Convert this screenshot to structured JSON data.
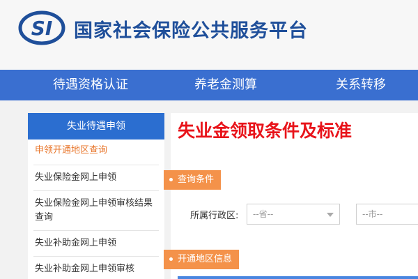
{
  "header": {
    "title": "国家社会保险公共服务平台",
    "logo_text": "SI"
  },
  "nav": {
    "items": [
      "待遇资格认证",
      "养老金测算",
      "关系转移"
    ]
  },
  "sidebar": {
    "heading": "失业待遇申领",
    "items": [
      "申领开通地区查询",
      "失业保险金网上申领",
      "失业保险金网上申领审核结果查询",
      "失业补助金网上申领",
      "失业补助金网上申领审核"
    ]
  },
  "main": {
    "title": "失业金领取条件及标准",
    "query_section": "查询条件",
    "region_label": "所属行政区:",
    "province_placeholder": "--省--",
    "city_placeholder": "--市--",
    "open_region_section": "开通地区信息"
  },
  "colors": {
    "brand_blue": "#3a6fd0",
    "title_red": "#e8131a",
    "accent_orange": "#f4924a"
  }
}
